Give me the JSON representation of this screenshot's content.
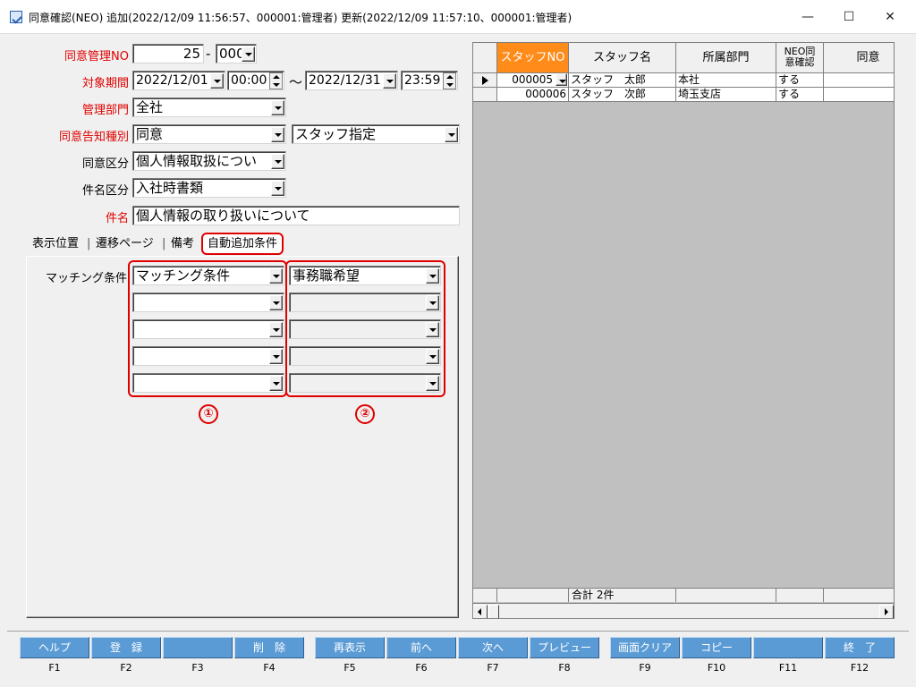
{
  "window": {
    "title": "同意確認(NEO) 追加(2022/12/09 11:56:57、000001:管理者) 更新(2022/12/09 11:57:10、000001:管理者)",
    "minimize": "—",
    "maximize": "☐",
    "close": "✕"
  },
  "form": {
    "mgmt_no_label": "同意管理NO",
    "mgmt_no_value": "25",
    "mgmt_no_sep": "-",
    "mgmt_no_sub": "000",
    "period_label": "対象期間",
    "period_from_date": "2022/12/01",
    "period_from_time": "00:00",
    "period_tilde": "～",
    "period_to_date": "2022/12/31",
    "period_to_time": "23:59",
    "dept_label": "管理部門",
    "dept_value": "全社",
    "notify_type_label": "同意告知種別",
    "notify_type_value": "同意",
    "notify_target_value": "スタッフ指定",
    "category_label": "同意区分",
    "category_value": "個人情報取扱につい",
    "subject_type_label": "件名区分",
    "subject_type_value": "入社時書類",
    "subject_label": "件名",
    "subject_value": "個人情報の取り扱いについて"
  },
  "tabs": [
    {
      "label": "表示位置"
    },
    {
      "label": "遷移ページ"
    },
    {
      "label": "備考"
    },
    {
      "label": "自動追加条件"
    }
  ],
  "tab_sep": "|",
  "matching": {
    "label": "マッチング条件",
    "col1": [
      "マッチング条件",
      "",
      "",
      "",
      ""
    ],
    "col2": [
      "事務職希望",
      "",
      "",
      "",
      ""
    ],
    "marker1": "①",
    "marker2": "②"
  },
  "grid": {
    "columns": [
      "スタッフNO",
      "スタッフ名",
      "所属部門",
      "NEO同\n意確認",
      "同意"
    ],
    "rows": [
      {
        "no": "000005",
        "name": "スタッフ　太郎",
        "dept": "本社",
        "neo": "する"
      },
      {
        "no": "000006",
        "name": "スタッフ　次郎",
        "dept": "埼玉支店",
        "neo": "する"
      }
    ],
    "total": "合計 2件",
    "colors": {
      "highlight_header": "#ff8c1a"
    }
  },
  "fkeys": [
    {
      "label": "ヘルプ",
      "key": "F1"
    },
    {
      "label": "登　録",
      "key": "F2"
    },
    {
      "label": "",
      "key": "F3"
    },
    {
      "label": "削　除",
      "key": "F4"
    },
    {
      "label": "再表示",
      "key": "F5"
    },
    {
      "label": "前へ",
      "key": "F6"
    },
    {
      "label": "次へ",
      "key": "F7"
    },
    {
      "label": "プレビュー",
      "key": "F8"
    },
    {
      "label": "画面クリア",
      "key": "F9"
    },
    {
      "label": "コピー",
      "key": "F10"
    },
    {
      "label": "",
      "key": "F11"
    },
    {
      "label": "終　了",
      "key": "F12"
    }
  ]
}
